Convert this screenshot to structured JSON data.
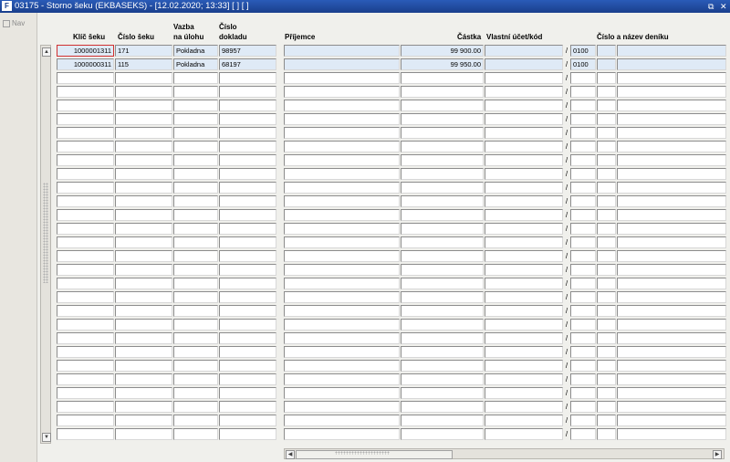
{
  "window": {
    "title": "03175 - Storno šeku (EKBASEKS) - [12.02.2020; 13:33]  [ ]  [ ]",
    "logo": "F",
    "restore_glyph": "⧉",
    "close_glyph": "✕"
  },
  "nav": {
    "label": "Nav"
  },
  "columns": {
    "klic": "Klíč šeku",
    "cislo": "Číslo šeku",
    "vazba_1": "Vazba",
    "vazba_2": "na úlohu",
    "doklad_1": "Číslo",
    "doklad_2": "dokladu",
    "prijemce": "Příjemce",
    "castka": "Částka",
    "ucet": "Vlastní účet/kód",
    "denik": "Číslo a název deníku"
  },
  "rows": [
    {
      "klic": "1000001311",
      "cislo": "171",
      "vazba": "Pokladna",
      "doklad": "98957",
      "prijemce": "",
      "castka": "99 900.00",
      "ucet": "",
      "kod": "0100",
      "denik_cislo": "",
      "denik_nazev": ""
    },
    {
      "klic": "1000000311",
      "cislo": "115",
      "vazba": "Pokladna",
      "doklad": "68197",
      "prijemce": "",
      "castka": "99 950.00",
      "ucet": "",
      "kod": "0100",
      "denik_cislo": "",
      "denik_nazev": ""
    }
  ],
  "separator": "/",
  "scroll": {
    "up": "▲",
    "down": "▼",
    "left": "◀",
    "right": "▶"
  },
  "colors": {
    "title_bar": "#1a3f8c",
    "selected_row": "#dfeaf6",
    "focus_border": "#d03030"
  }
}
